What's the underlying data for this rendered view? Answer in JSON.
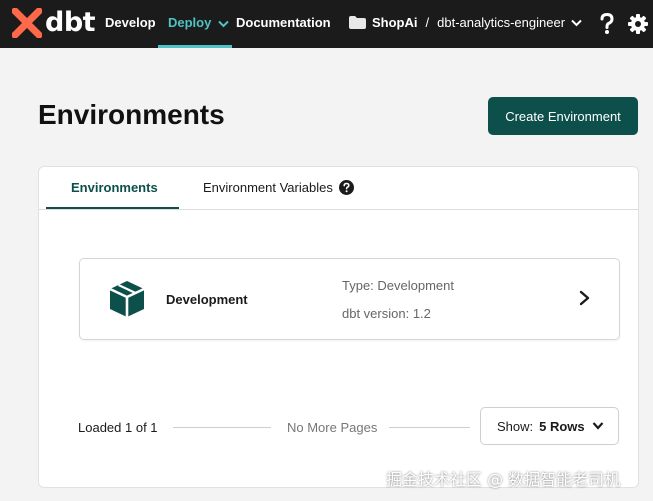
{
  "topbar": {
    "logo_text": "dbt",
    "nav": {
      "develop": "Develop",
      "deploy": "Deploy",
      "documentation": "Documentation"
    },
    "account": "ShopAi",
    "separator": "/",
    "project": "dbt-analytics-engineer",
    "colors": {
      "background": "#1b1b1b",
      "active": "#4fc3c3",
      "logo": "#ff694b"
    }
  },
  "page": {
    "title": "Environments",
    "create_button": "Create Environment"
  },
  "tabs": {
    "environments": "Environments",
    "environment_variables": "Environment Variables"
  },
  "environments": [
    {
      "name": "Development",
      "type": "Type: Development",
      "version": "dbt version: 1.2",
      "icon": "cube-icon"
    }
  ],
  "pagination": {
    "loaded": "Loaded 1 of 1",
    "status": "No More Pages",
    "show_label": "Show:",
    "rows": "5 Rows"
  },
  "watermark": "掘金技术社区 @ 数据智能老司机",
  "colors": {
    "primary": "#0d4f4a"
  }
}
